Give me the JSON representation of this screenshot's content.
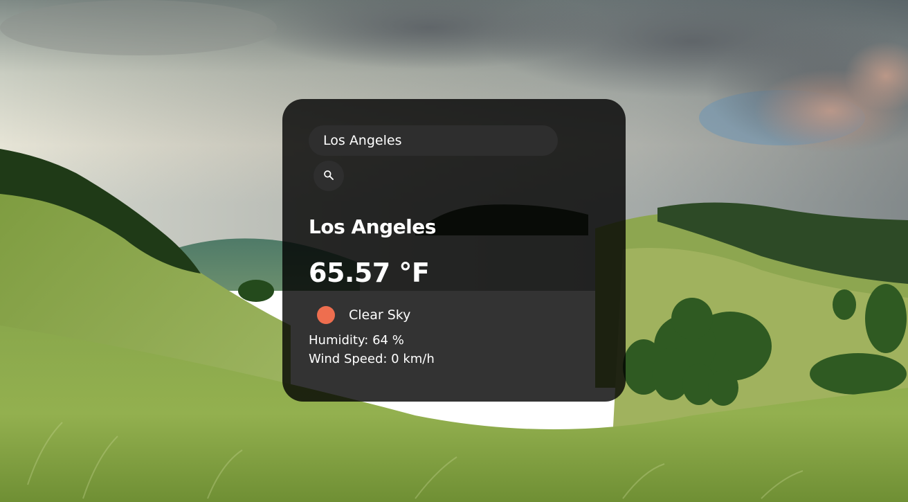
{
  "search": {
    "value": "Los Angeles",
    "icon": "search-icon"
  },
  "weather": {
    "city": "Los Angeles",
    "temperature": "65.57 °F",
    "icon": "sun-icon",
    "icon_color": "#ee6e4f",
    "description": "Clear Sky",
    "humidity": "Humidity: 64 %",
    "wind_speed": "Wind Speed: 0 km/h"
  },
  "colors": {
    "card_background": "rgba(0,0,0,0.80)",
    "input_background": "#2e2e2e",
    "text": "#ffffff"
  }
}
